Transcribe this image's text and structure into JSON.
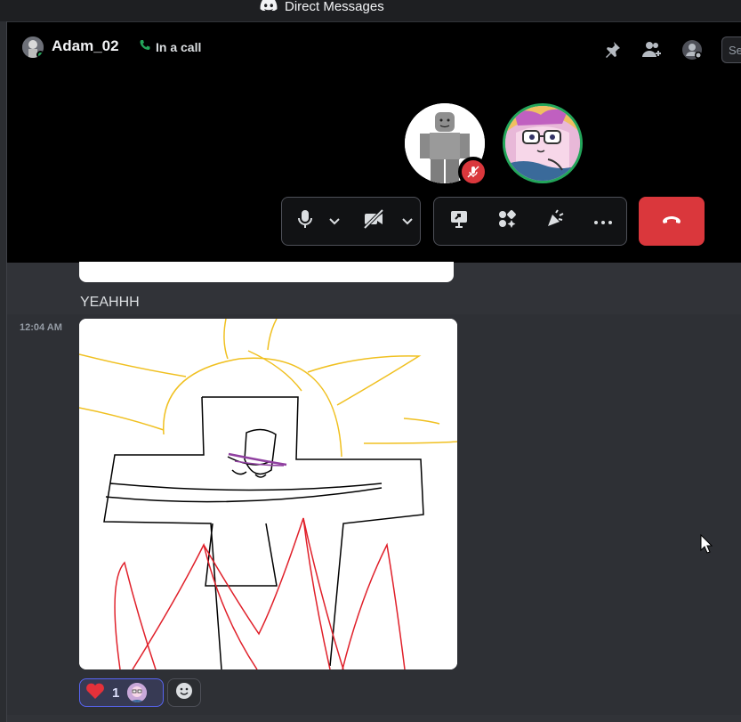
{
  "titlebar": {
    "title": "Direct Messages",
    "icon": "discord-logo-icon"
  },
  "call": {
    "header": {
      "username": "Adam_02",
      "call_status": "In a call",
      "search_placeholder": "Se"
    },
    "participants": [
      {
        "name": "roblox-avatar",
        "muted": true
      },
      {
        "name": "anime-avatar",
        "speaking": true
      }
    ],
    "controls": {
      "group1": [
        "microphone-icon",
        "chevron-down-icon",
        "camera-off-icon",
        "chevron-down-icon"
      ],
      "group2": [
        "screen-share-icon",
        "activities-icon",
        "soundboard-icon",
        "more-icon"
      ],
      "end_call": "end-call-icon"
    }
  },
  "messages": [
    {
      "text": "YEAHHH"
    },
    {
      "timestamp": "12:04 AM",
      "attachment": "drawing-image",
      "reactions": [
        {
          "emoji": "heart",
          "count": "1"
        }
      ]
    }
  ],
  "colors": {
    "accent": "#5865f2",
    "danger": "#da373c",
    "online": "#23a55a",
    "background": "#313338"
  }
}
